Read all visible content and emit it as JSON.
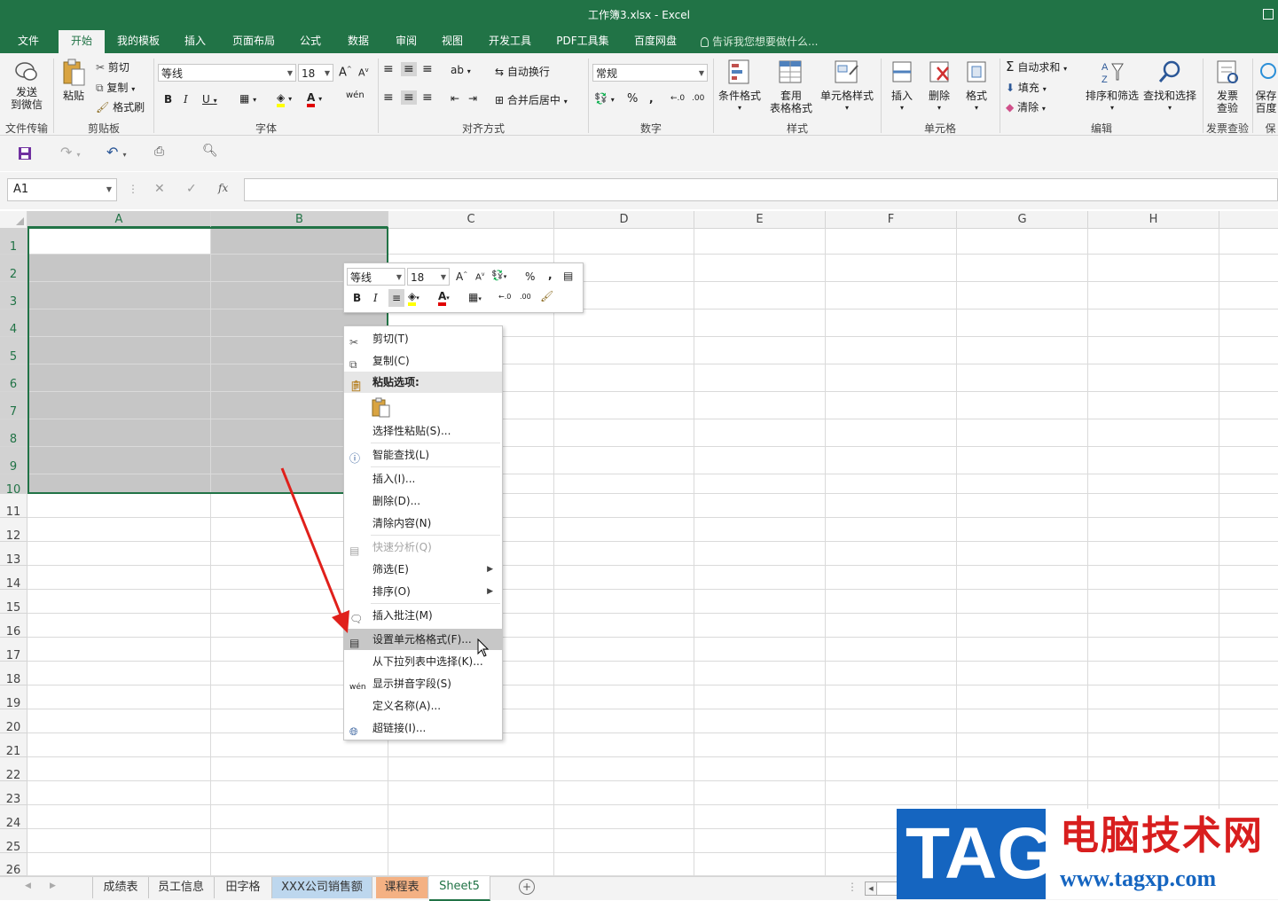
{
  "window": {
    "title": "工作簿3.xlsx - Excel"
  },
  "ribbon_tabs": [
    "文件",
    "开始",
    "我的模板",
    "插入",
    "页面布局",
    "公式",
    "数据",
    "审阅",
    "视图",
    "开发工具",
    "PDF工具集",
    "百度网盘"
  ],
  "active_tab": "开始",
  "tell_me": "告诉我您想要做什么...",
  "ribbon": {
    "send_wechat": "发送\n到微信",
    "paste": "粘贴",
    "cut": "剪切",
    "copy": "复制",
    "format_painter": "格式刷",
    "font_name": "等线",
    "font_size": "18",
    "wrap_text": "自动换行",
    "merge_center": "合并后居中",
    "number_format": "常规",
    "cond_format": "条件格式",
    "table_format_1": "套用",
    "table_format_2": "表格格式",
    "cell_style": "单元格样式",
    "insert": "插入",
    "delete": "删除",
    "format": "格式",
    "autosum": "自动求和",
    "fill": "填充",
    "clear": "清除",
    "sort_filter": "排序和筛选",
    "find_select": "查找和选择",
    "invoice_1": "发票",
    "invoice_2": "查验",
    "save_1": "保存",
    "save_2": "百度",
    "groups": {
      "file_transfer": "文件传输",
      "clipboard": "剪贴板",
      "font": "字体",
      "alignment": "对齐方式",
      "number": "数字",
      "styles": "样式",
      "cells": "单元格",
      "editing": "编辑",
      "invoice": "发票查验",
      "save": "保"
    }
  },
  "formula_bar": {
    "name_box": "A1",
    "fx": "fx",
    "value": ""
  },
  "columns": [
    "A",
    "B",
    "C",
    "D",
    "E",
    "F",
    "G",
    "H"
  ],
  "rows": [
    "1",
    "2",
    "3",
    "4",
    "5",
    "6",
    "7",
    "8",
    "9",
    "10",
    "11",
    "12",
    "13",
    "14",
    "15",
    "16",
    "17",
    "18",
    "19",
    "20",
    "21",
    "22",
    "23",
    "24",
    "25",
    "26"
  ],
  "mini_toolbar": {
    "font": "等线",
    "size": "18",
    "bold": "B",
    "italic": "I",
    "percent": "%",
    "comma": ","
  },
  "context_menu": [
    {
      "label": "剪切(T)",
      "icon": "scissors-icon"
    },
    {
      "label": "复制(C)",
      "icon": "copy-icon"
    },
    {
      "label": "粘贴选项:",
      "icon": "paste-icon",
      "header": true
    },
    {
      "label": "选择性粘贴(S)...",
      "icon": ""
    },
    {
      "label": "智能查找(L)",
      "icon": "smart-lookup-icon"
    },
    {
      "label": "插入(I)...",
      "icon": ""
    },
    {
      "label": "删除(D)...",
      "icon": ""
    },
    {
      "label": "清除内容(N)",
      "icon": ""
    },
    {
      "label": "快速分析(Q)",
      "icon": "quick-analysis-icon",
      "disabled": true
    },
    {
      "label": "筛选(E)",
      "icon": "",
      "submenu": true
    },
    {
      "label": "排序(O)",
      "icon": "",
      "submenu": true
    },
    {
      "label": "插入批注(M)",
      "icon": "comment-icon"
    },
    {
      "label": "设置单元格格式(F)...",
      "icon": "format-cells-icon",
      "highlighted": true
    },
    {
      "label": "从下拉列表中选择(K)...",
      "icon": ""
    },
    {
      "label": "显示拼音字段(S)",
      "icon": "phonetic-icon"
    },
    {
      "label": "定义名称(A)...",
      "icon": ""
    },
    {
      "label": "超链接(I)...",
      "icon": "hyperlink-icon"
    }
  ],
  "sheet_tabs": [
    {
      "label": "成绩表",
      "color": "#f3f3f3"
    },
    {
      "label": "员工信息",
      "color": "#f3f3f3"
    },
    {
      "label": "田字格",
      "color": "#f3f3f3"
    },
    {
      "label": "XXX公司销售额",
      "color": "#bdd7ee"
    },
    {
      "label": "课程表",
      "color": "#f4b183"
    },
    {
      "label": "Sheet5",
      "color": "#ffffff",
      "active": true
    }
  ],
  "watermark": {
    "tag": "TAG",
    "cn": "电脑技术网",
    "url": "www.tagxp.com"
  },
  "colors": {
    "excel_green": "#217346",
    "selection_gray": "#c6c6c6",
    "arrow_red": "#e0201b"
  }
}
